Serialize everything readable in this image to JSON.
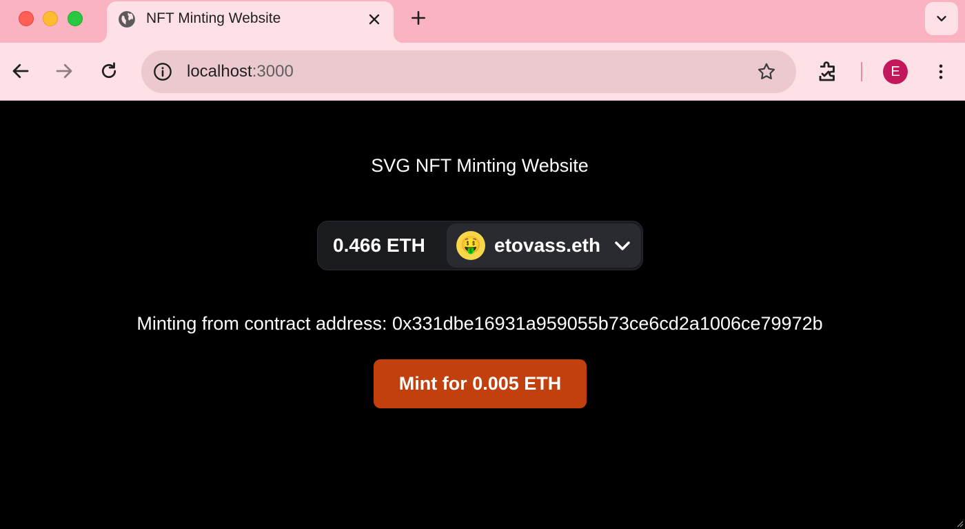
{
  "browser": {
    "tab": {
      "title": "NFT Minting Website",
      "favicon": "globe-icon"
    },
    "address_bar": {
      "host": "localhost",
      "port": ":3000"
    },
    "profile_initial": "E",
    "colors": {
      "tabbar": "#fbb3c1",
      "toolbar": "#fde1e6",
      "omnibox": "#ecc9cf",
      "avatar": "#c2185b"
    }
  },
  "page": {
    "heading": "SVG NFT Minting Website",
    "wallet": {
      "balance": "0.466 ETH",
      "account_name": "etovass.eth",
      "account_avatar_emoji": "🤑"
    },
    "contract_text": "Minting from contract address: 0x331dbe16931a959055b73ce6cd2a1006ce79972b",
    "mint_button_label": "Mint for 0.005 ETH",
    "colors": {
      "background": "#000000",
      "mint_button": "#c1400d",
      "wallet_bg": "#1a1b1f",
      "account_bg": "#2a2b30"
    }
  }
}
